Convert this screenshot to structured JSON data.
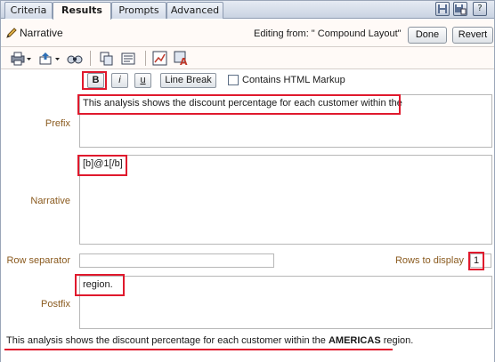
{
  "tabs": [
    "Criteria",
    "Results",
    "Prompts",
    "Advanced"
  ],
  "active_tab": "Results",
  "header": {
    "title": "Narrative",
    "editing_from": "Editing from: \" Compound Layout\"",
    "done_label": "Done",
    "revert_label": "Revert"
  },
  "toolbar": {
    "icons": [
      "print-icon",
      "export-icon",
      "preview-icon",
      "copy-view-icon",
      "paste-view-icon",
      "chart-icon",
      "format-icon"
    ]
  },
  "format": {
    "bold_label": "B",
    "italic_label": "i",
    "underline_label": "u",
    "line_break_label": "Line Break",
    "html_markup_label": "Contains HTML Markup",
    "html_markup_checked": false
  },
  "fields": {
    "prefix_label": "Prefix",
    "prefix_value": "This analysis shows the discount percentage for each customer within the",
    "narrative_label": "Narrative",
    "narrative_value": "[b]@1[/b]",
    "row_separator_label": "Row separator",
    "row_separator_value": "",
    "rows_to_display_label": "Rows to display",
    "rows_to_display_value": "1",
    "postfix_label": "Postfix",
    "postfix_value": "region."
  },
  "result": {
    "before": "This analysis shows the discount percentage for each customer within the",
    "bold": "AMERICAS",
    "after": "region."
  },
  "colors": {
    "highlight": "#e0192d",
    "label": "#8a5a1e",
    "panel": "#fffaf7"
  }
}
